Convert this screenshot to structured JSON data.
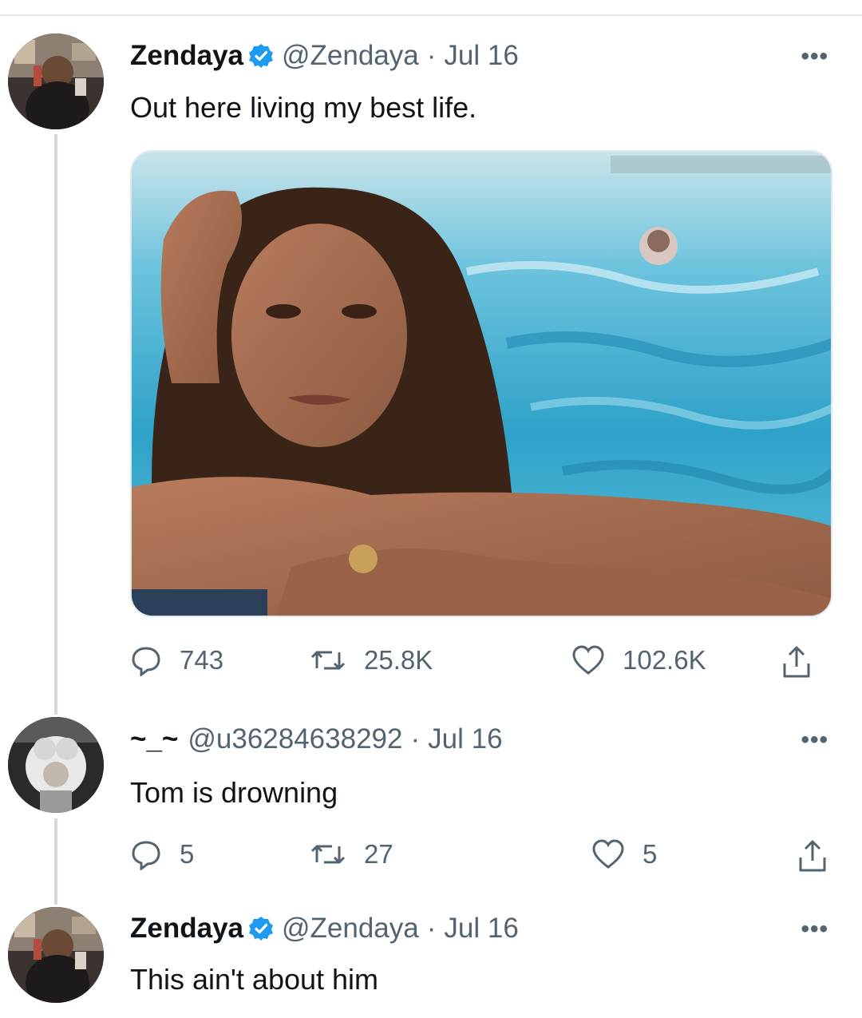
{
  "thread": {
    "tweets": [
      {
        "name": "Zendaya",
        "handle": "@Zendaya",
        "date": "Jul 16",
        "text": "Out here living my best life.",
        "replies": "743",
        "retweets": "25.8K",
        "likes": "102.6K",
        "verified": true
      },
      {
        "name": "~_~",
        "handle": "@u36284638292",
        "date": "Jul 16",
        "text": "Tom is drowning",
        "replies": "5",
        "retweets": "27",
        "likes": "5",
        "verified": false
      },
      {
        "name": "Zendaya",
        "handle": "@Zendaya",
        "date": "Jul 16",
        "text": "This ain't about him",
        "verified": true
      }
    ],
    "separator": "·",
    "more_label": "•••"
  },
  "icons": {
    "reply": "reply-icon",
    "retweet": "retweet-icon",
    "like": "heart-icon",
    "share": "share-icon",
    "verified": "verified-badge-icon",
    "more": "more-icon"
  },
  "colors": {
    "text": "#0f1419",
    "muted": "#536471",
    "verified": "#1d9bf0",
    "thread_line": "#cfd9de"
  }
}
